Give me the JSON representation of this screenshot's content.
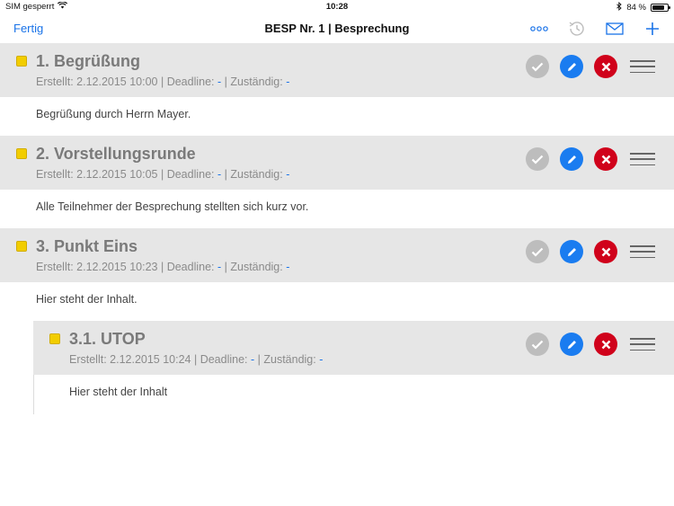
{
  "status_bar": {
    "carrier": "SIM gesperrt",
    "time": "10:28",
    "battery_text": "84 %",
    "battery_level": 0.84
  },
  "nav": {
    "back_label": "Fertig",
    "title": "BESP Nr. 1 | Besprechung",
    "icons": [
      "more-icon",
      "history-icon",
      "mail-icon",
      "add-icon"
    ]
  },
  "colors": {
    "accent": "#1a73e8",
    "bullet": "#f2cd00",
    "check": "#bdbdbd",
    "edit": "#1a7cf0",
    "delete": "#d0021b",
    "header_bg": "#e6e6e6"
  },
  "items": [
    {
      "title": "1. Begrüßung",
      "created_label": "Erstellt: 2.12.2015 10:00 | Deadline: ",
      "deadline": "-",
      "assignee_label": " | Zuständig: ",
      "assignee": "-",
      "content": "Begrüßung durch Herrn Mayer."
    },
    {
      "title": "2. Vorstellungsrunde",
      "created_label": "Erstellt: 2.12.2015 10:05 | Deadline: ",
      "deadline": "-",
      "assignee_label": " | Zuständig: ",
      "assignee": "-",
      "content": "Alle Teilnehmer der Besprechung stellten sich kurz vor."
    },
    {
      "title": "3. Punkt Eins",
      "created_label": "Erstellt: 2.12.2015 10:23 | Deadline: ",
      "deadline": "-",
      "assignee_label": " | Zuständig: ",
      "assignee": "-",
      "content": "Hier steht der Inhalt."
    },
    {
      "title": "3.1. UTOP",
      "created_label": "Erstellt: 2.12.2015 10:24 | Deadline: ",
      "deadline": "-",
      "assignee_label": " | Zuständig: ",
      "assignee": "-",
      "content": "Hier steht der Inhalt"
    }
  ]
}
